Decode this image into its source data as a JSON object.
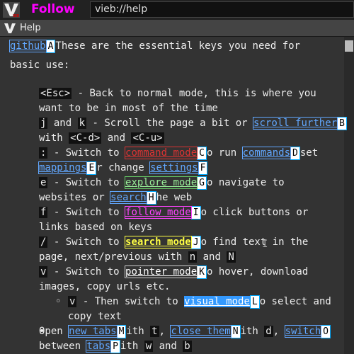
{
  "navbar": {
    "mode_label": "Follow",
    "url": "vieb://help"
  },
  "tab": {
    "title": "Help"
  },
  "content": {
    "intro_link": "github",
    "intro_text": "These are the essential keys you need for",
    "intro_text2": "basic use:",
    "hints": [
      "A",
      "B",
      "C",
      "D",
      "E",
      "F",
      "G",
      "H",
      "I",
      "J",
      "K",
      "L",
      "M",
      "N",
      "O",
      "P"
    ],
    "items": {
      "esc": {
        "key": "<Esc>",
        "t1": " - Back to normal mode, this is where you",
        "t2": "want to be in most of the time"
      },
      "jk": {
        "k1": "j",
        "and": " and ",
        "k2": "k",
        "t1": " - Scroll the page a bit or ",
        "link": "scroll further",
        "t2a": "with ",
        "k3": "<C-d>",
        "t2b": " and ",
        "k4": "<C-u>"
      },
      "colon": {
        "key": ":",
        "t1": " - Switch to ",
        "link1": "command mode",
        "t2": "o run ",
        "link2": "commands",
        "t3": "set",
        "link3": "mappings",
        "t4": "r change ",
        "link4": "settings"
      },
      "e": {
        "key": "e",
        "t1": " - Switch to ",
        "link1": "explore mode",
        "t2": "o navigate to",
        "t3": "websites or ",
        "link2": "search",
        "t4": "he web"
      },
      "f": {
        "key": "f",
        "t1": " - Switch to ",
        "link1": "follow mode",
        "t2": "o click buttons or",
        "t3": "links based on keys"
      },
      "slash": {
        "key": "/",
        "t1": " - Switch to ",
        "link1": "search mode",
        "t2": "o find text in the",
        "t3a": "page, next/previous with ",
        "k1": "n",
        "and": " and ",
        "k2": "N"
      },
      "v": {
        "key": "v",
        "t1": " - Switch to ",
        "link1": "pointer mode",
        "t2": "o hover, download",
        "t3": "images, copy urls etc."
      },
      "v2": {
        "key": "v",
        "t1": " - Then switch to ",
        "link1": "visual mode",
        "t2": "o select and",
        "t3": "copy text"
      },
      "open": {
        "t1": "Open ",
        "link1": "new tabs",
        "t2": "ith ",
        "k1": "t",
        "t3": ", ",
        "link2": "close them",
        "t4": "ith ",
        "k2": "d",
        "t5": ", ",
        "link3": "switch",
        "t6": "between ",
        "link4": "tabs",
        "t7": "ith ",
        "k3": "w",
        "and": " and ",
        "k4": "b"
      }
    }
  },
  "colors": {
    "background": "#333333",
    "mode": "#ff00ff",
    "link": "#61a7ff"
  }
}
